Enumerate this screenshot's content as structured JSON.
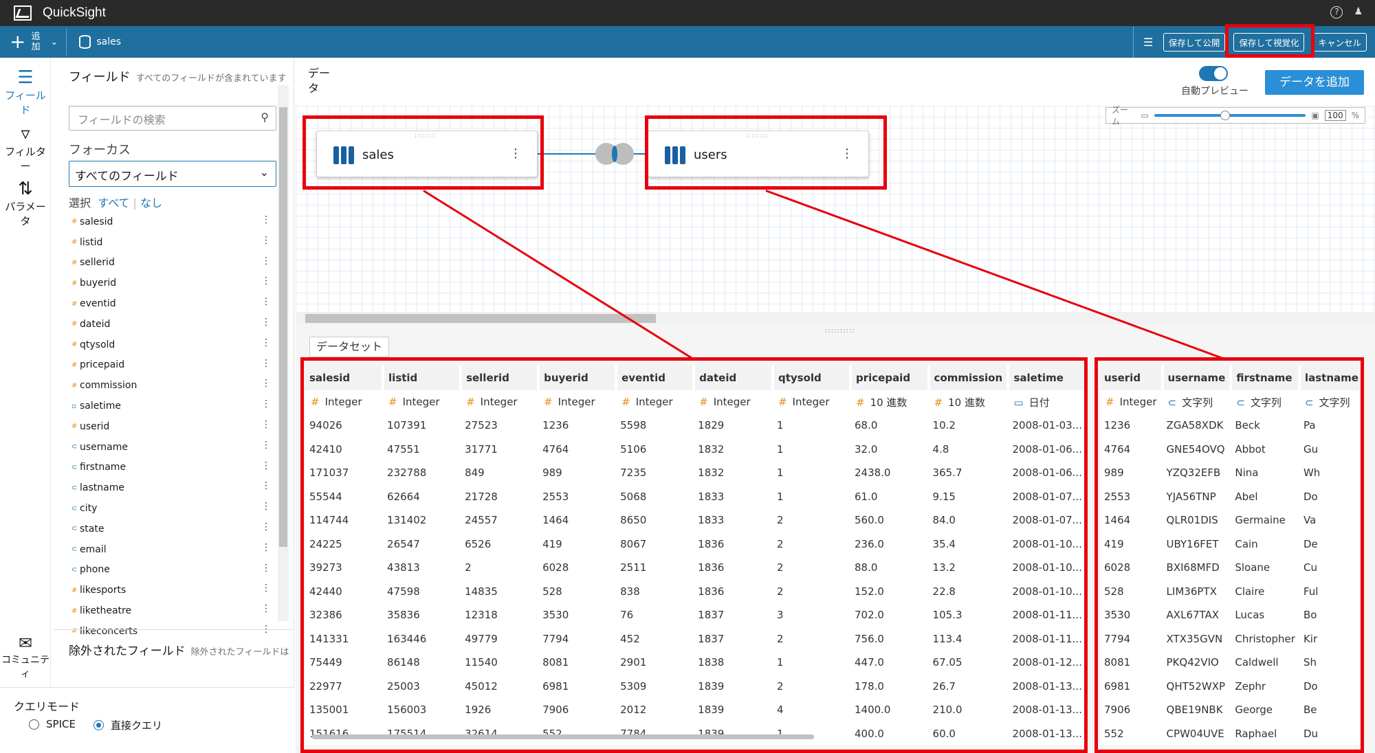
{
  "app": {
    "title": "QuickSight"
  },
  "toolbar": {
    "add_label": "追加",
    "dataset_name": "sales",
    "publish_label": "保存して公開",
    "visualize_label": "保存して視覚化",
    "cancel_label": "キャンセル"
  },
  "rail": {
    "fields": "フィールド",
    "filters": "フィルター",
    "parameters": "パラメータ",
    "community": "コミュニティ"
  },
  "field_panel": {
    "title": "フィールド",
    "subtitle": "すべてのフィールドが含まれています",
    "search_placeholder": "フィールドの検索",
    "focus_label": "フォーカス",
    "focus_value": "すべてのフィールド",
    "select_label": "選択",
    "select_all": "すべて",
    "select_none": "なし",
    "fields": [
      {
        "name": "salesid",
        "type": "num"
      },
      {
        "name": "listid",
        "type": "num"
      },
      {
        "name": "sellerid",
        "type": "num"
      },
      {
        "name": "buyerid",
        "type": "num"
      },
      {
        "name": "eventid",
        "type": "num"
      },
      {
        "name": "dateid",
        "type": "num"
      },
      {
        "name": "qtysold",
        "type": "num"
      },
      {
        "name": "pricepaid",
        "type": "num"
      },
      {
        "name": "commission",
        "type": "num"
      },
      {
        "name": "saletime",
        "type": "date"
      },
      {
        "name": "userid",
        "type": "num"
      },
      {
        "name": "username",
        "type": "str"
      },
      {
        "name": "firstname",
        "type": "str"
      },
      {
        "name": "lastname",
        "type": "str"
      },
      {
        "name": "city",
        "type": "str"
      },
      {
        "name": "state",
        "type": "str"
      },
      {
        "name": "email",
        "type": "str"
      },
      {
        "name": "phone",
        "type": "str"
      },
      {
        "name": "likesports",
        "type": "num"
      },
      {
        "name": "liketheatre",
        "type": "num"
      },
      {
        "name": "likeconcerts",
        "type": "num"
      }
    ],
    "excluded_title": "除外されたフィールド",
    "excluded_subtitle": "除外されたフィールドは"
  },
  "query_mode": {
    "label": "クエリモード",
    "spice": "SPICE",
    "direct": "直接クエリ",
    "selected": "direct"
  },
  "canvas": {
    "data_label": "データ",
    "auto_preview": "自動プレビュー",
    "auto_preview_on": true,
    "add_data": "データを追加",
    "zoom_label": "ズーム",
    "zoom_value": "100",
    "zoom_unit": "%",
    "nodes": [
      {
        "name": "sales"
      },
      {
        "name": "users"
      }
    ]
  },
  "dataset_tab": "データセット",
  "sales_table": {
    "columns": [
      {
        "name": "salesid",
        "type": "Integer",
        "kind": "num"
      },
      {
        "name": "listid",
        "type": "Integer",
        "kind": "num"
      },
      {
        "name": "sellerid",
        "type": "Integer",
        "kind": "num"
      },
      {
        "name": "buyerid",
        "type": "Integer",
        "kind": "num"
      },
      {
        "name": "eventid",
        "type": "Integer",
        "kind": "num"
      },
      {
        "name": "dateid",
        "type": "Integer",
        "kind": "num"
      },
      {
        "name": "qtysold",
        "type": "Integer",
        "kind": "num"
      },
      {
        "name": "pricepaid",
        "type": "10 進数",
        "kind": "num"
      },
      {
        "name": "commission",
        "type": "10 進数",
        "kind": "num"
      },
      {
        "name": "saletime",
        "type": "日付",
        "kind": "date"
      }
    ],
    "rows": [
      [
        "94026",
        "107391",
        "27523",
        "1236",
        "5598",
        "1829",
        "1",
        "68.0",
        "10.2",
        "2008-01-03..."
      ],
      [
        "42410",
        "47551",
        "31771",
        "4764",
        "5106",
        "1832",
        "1",
        "32.0",
        "4.8",
        "2008-01-06..."
      ],
      [
        "171037",
        "232788",
        "849",
        "989",
        "7235",
        "1832",
        "1",
        "2438.0",
        "365.7",
        "2008-01-06..."
      ],
      [
        "55544",
        "62664",
        "21728",
        "2553",
        "5068",
        "1833",
        "1",
        "61.0",
        "9.15",
        "2008-01-07..."
      ],
      [
        "114744",
        "131402",
        "24557",
        "1464",
        "8650",
        "1833",
        "2",
        "560.0",
        "84.0",
        "2008-01-07..."
      ],
      [
        "24225",
        "26547",
        "6526",
        "419",
        "8067",
        "1836",
        "2",
        "236.0",
        "35.4",
        "2008-01-10..."
      ],
      [
        "39273",
        "43813",
        "2",
        "6028",
        "2511",
        "1836",
        "2",
        "88.0",
        "13.2",
        "2008-01-10..."
      ],
      [
        "42440",
        "47598",
        "14835",
        "528",
        "838",
        "1836",
        "2",
        "152.0",
        "22.8",
        "2008-01-10..."
      ],
      [
        "32386",
        "35836",
        "12318",
        "3530",
        "76",
        "1837",
        "3",
        "702.0",
        "105.3",
        "2008-01-11..."
      ],
      [
        "141331",
        "163446",
        "49779",
        "7794",
        "452",
        "1837",
        "2",
        "756.0",
        "113.4",
        "2008-01-11..."
      ],
      [
        "75449",
        "86148",
        "11540",
        "8081",
        "2901",
        "1838",
        "1",
        "447.0",
        "67.05",
        "2008-01-12..."
      ],
      [
        "22977",
        "25003",
        "45012",
        "6981",
        "5309",
        "1839",
        "2",
        "178.0",
        "26.7",
        "2008-01-13..."
      ],
      [
        "135001",
        "156003",
        "1926",
        "7906",
        "2012",
        "1839",
        "4",
        "1400.0",
        "210.0",
        "2008-01-13..."
      ],
      [
        "151616",
        "175514",
        "32614",
        "552",
        "7784",
        "1839",
        "1",
        "400.0",
        "60.0",
        "2008-01-13..."
      ]
    ]
  },
  "users_table": {
    "columns": [
      {
        "name": "userid",
        "type": "Integer",
        "kind": "num"
      },
      {
        "name": "username",
        "type": "文字列",
        "kind": "str"
      },
      {
        "name": "firstname",
        "type": "文字列",
        "kind": "str"
      },
      {
        "name": "lastname",
        "type": "文字列",
        "kind": "str"
      }
    ],
    "rows": [
      [
        "1236",
        "ZGA58XDK",
        "Beck",
        "Pa"
      ],
      [
        "4764",
        "GNE54OVQ",
        "Abbot",
        "Gu"
      ],
      [
        "989",
        "YZQ32EFB",
        "Nina",
        "Wh"
      ],
      [
        "2553",
        "YJA56TNP",
        "Abel",
        "Do"
      ],
      [
        "1464",
        "QLR01DIS",
        "Germaine",
        "Va"
      ],
      [
        "419",
        "UBY16FET",
        "Cain",
        "De"
      ],
      [
        "6028",
        "BXI68MFD",
        "Sloane",
        "Cu"
      ],
      [
        "528",
        "LIM36PTX",
        "Claire",
        "Ful"
      ],
      [
        "3530",
        "AXL67TAX",
        "Lucas",
        "Bo"
      ],
      [
        "7794",
        "XTX35GVN",
        "Christopher",
        "Kir"
      ],
      [
        "8081",
        "PKQ42VIO",
        "Caldwell",
        "Sh"
      ],
      [
        "6981",
        "QHT52WXP",
        "Zephr",
        "Do"
      ],
      [
        "7906",
        "QBE19NBK",
        "George",
        "Be"
      ],
      [
        "552",
        "CPW04UVE",
        "Raphael",
        "Du"
      ]
    ]
  },
  "colors": {
    "accent": "#1f77b4",
    "toolbar": "#1f6f9f",
    "highlight": "#e8000d"
  }
}
